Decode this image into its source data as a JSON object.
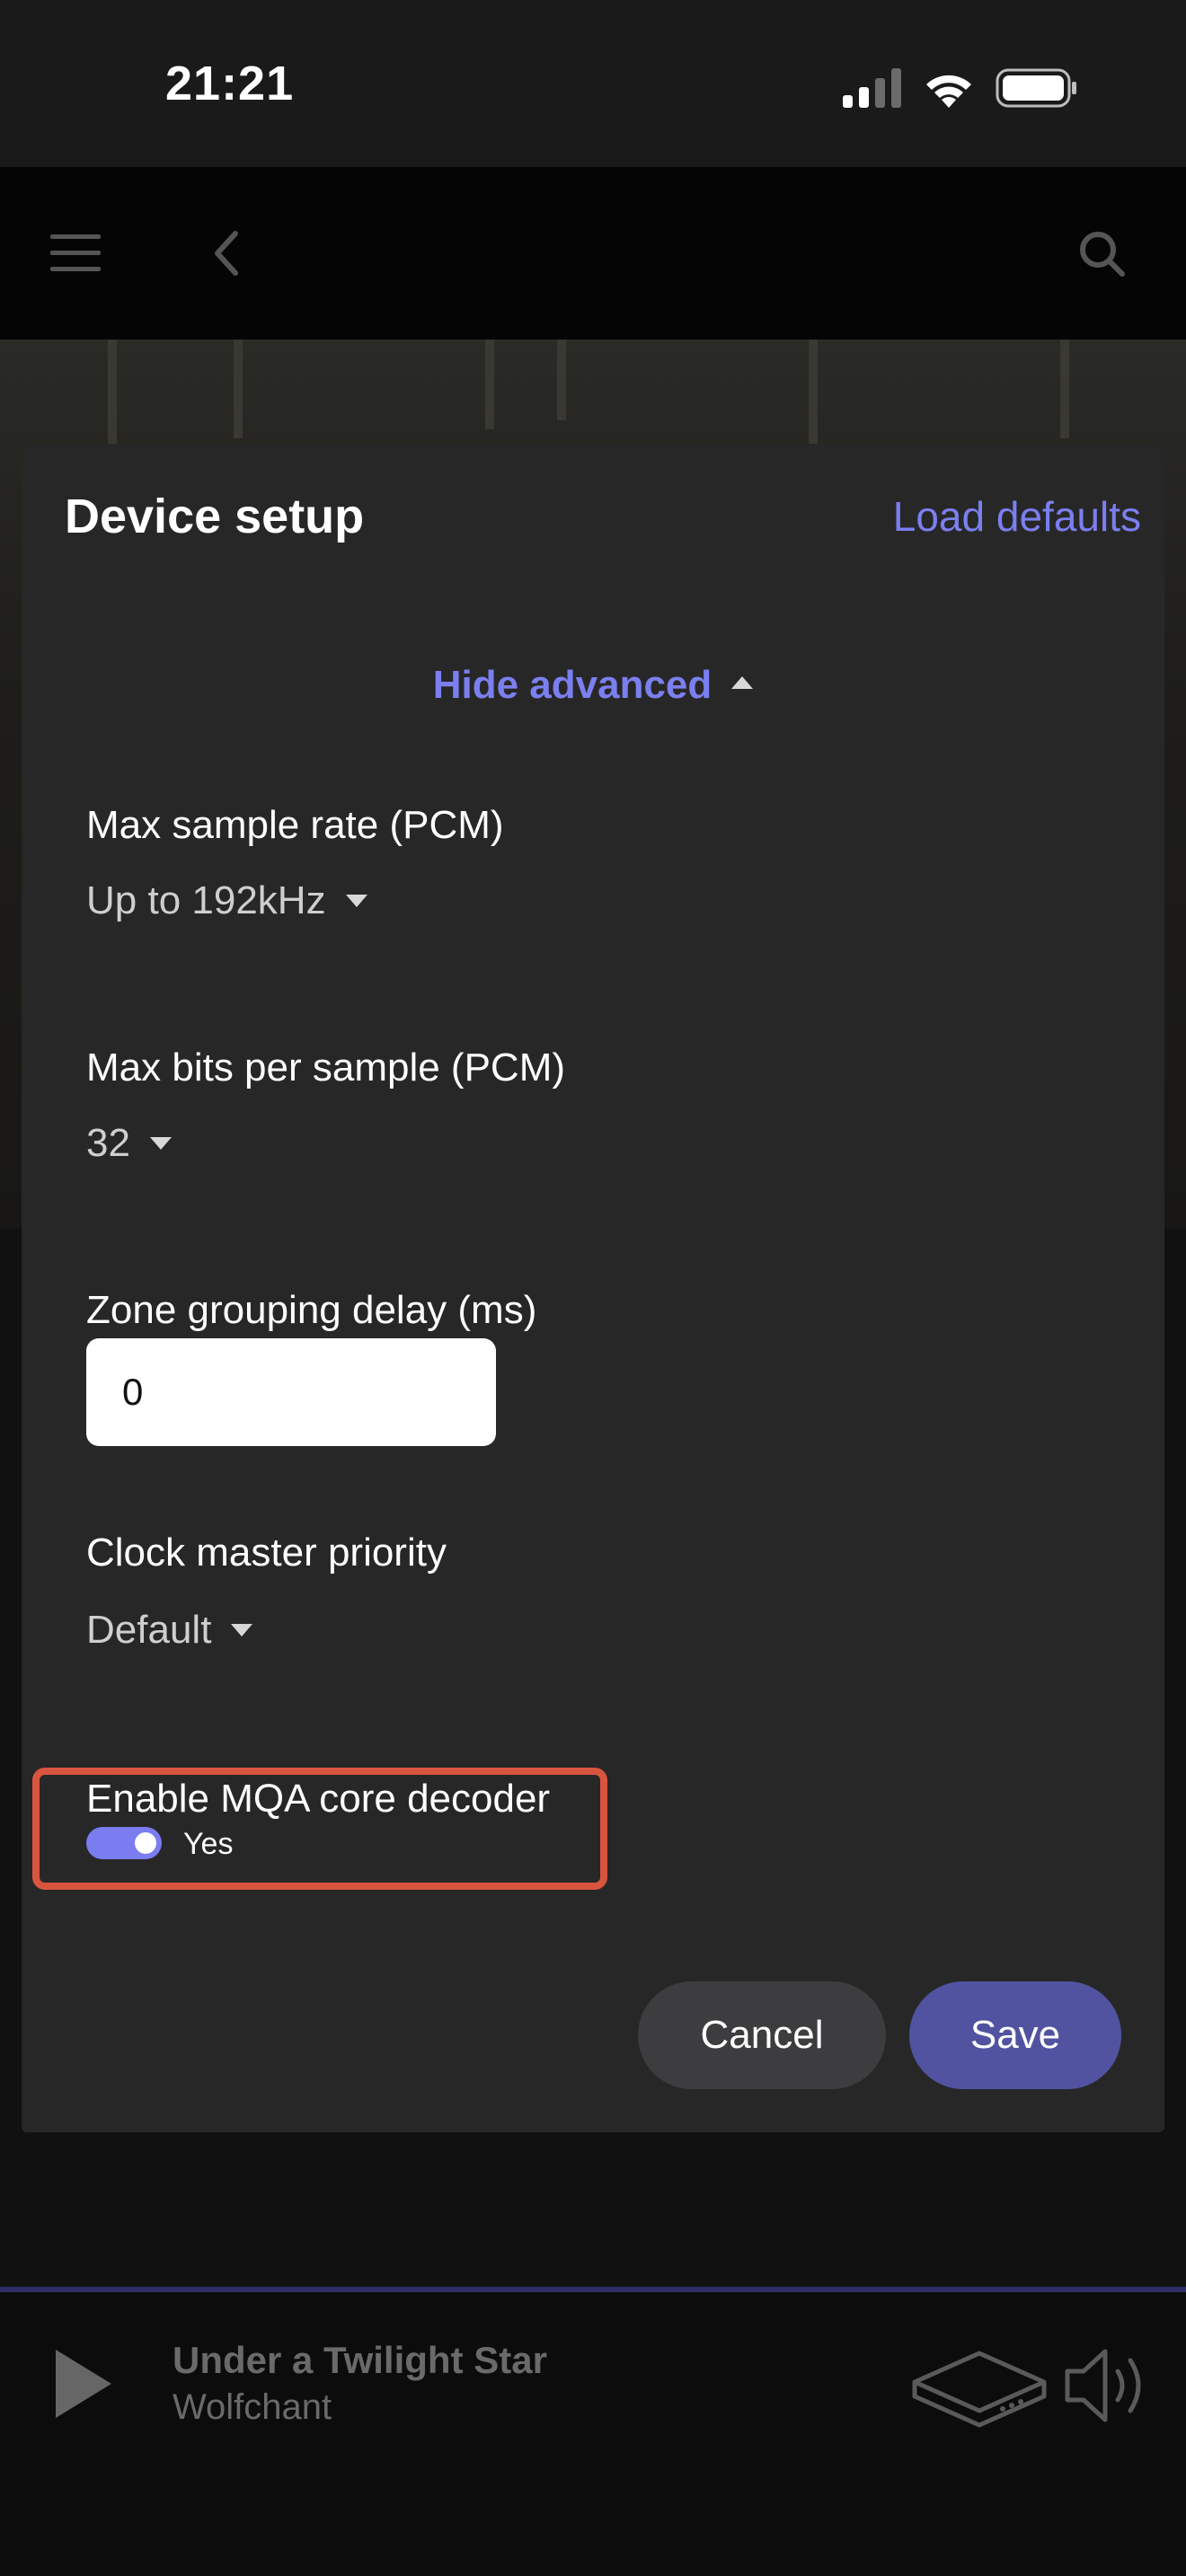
{
  "status_bar": {
    "time": "21:21"
  },
  "dialog": {
    "title": "Device setup",
    "load_defaults": "Load defaults",
    "hide_advanced": "Hide advanced",
    "fields": {
      "max_sample_rate": {
        "label": "Max sample rate (PCM)",
        "value": "Up to 192kHz"
      },
      "max_bits": {
        "label": "Max bits per sample (PCM)",
        "value": "32"
      },
      "zone_delay": {
        "label": "Zone grouping delay (ms)",
        "value": "0"
      },
      "clock_master": {
        "label": "Clock master priority",
        "value": "Default"
      },
      "mqa": {
        "label": "Enable MQA core decoder",
        "toggle_text": "Yes",
        "enabled": true
      }
    },
    "buttons": {
      "cancel": "Cancel",
      "save": "Save"
    }
  },
  "now_playing": {
    "title": "Under a Twilight Star",
    "artist": "Wolfchant"
  },
  "colors": {
    "accent": "#7c7ff0",
    "highlight": "#d9543f",
    "save": "#5153a0"
  }
}
